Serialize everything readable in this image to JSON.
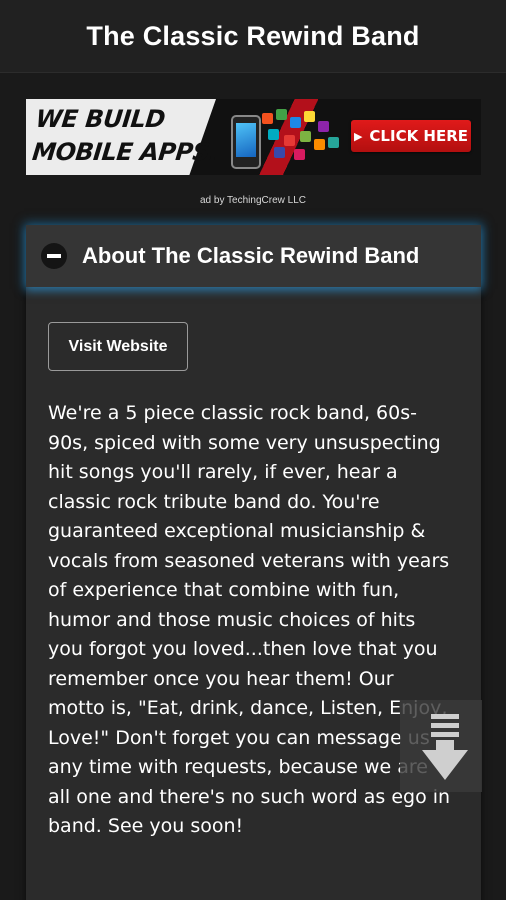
{
  "header": {
    "title": "The Classic Rewind Band"
  },
  "ad": {
    "headline": "WE BUILD MOBILE APPS.",
    "cta_label": "CLICK HERE",
    "credit": "ad by TechingCrew LLC",
    "colors": {
      "accent": "#c0121c",
      "light": "#ececec"
    }
  },
  "panel": {
    "title": "About The Classic Rewind Band",
    "expanded": true,
    "glow_color": "#2e96d6",
    "visit_button_label": "Visit Website",
    "description": "We're a 5 piece classic rock band, 60s-90s, spiced with some very unsuspecting hit songs you'll rarely, if ever, hear a classic rock tribute band do. You're guaranteed exceptional musicianship & vocals from seasoned veterans with years of experience that combine with fun, humor and those music choices of hits you forgot you loved...then love that you remember once you hear them! Our motto is, \"Eat, drink, dance, Listen, Enjoy, Love!\" Don't forget you can message us any time with requests, because we are all one and there's no such word as ego in band. See you soon!"
  },
  "icons": {
    "collapse": "minus-circle-icon",
    "scroll": "scroll-down-icon",
    "cta": "play-icon"
  }
}
